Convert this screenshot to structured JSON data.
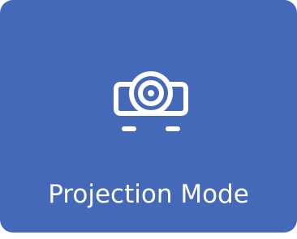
{
  "tile": {
    "label": "Projection Mode",
    "icon": "projector-icon",
    "background_color": "#4469b8",
    "foreground_color": "#ffffff"
  }
}
